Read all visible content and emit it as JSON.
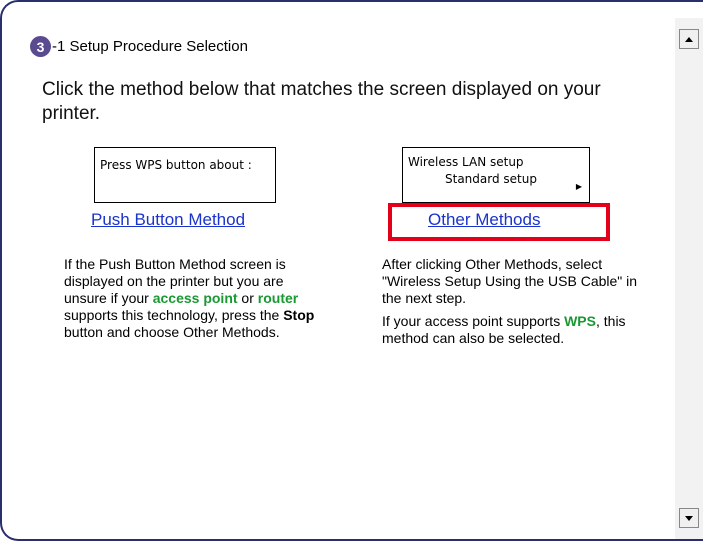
{
  "header": {
    "step_number": "3",
    "title": "-1 Setup Procedure Selection"
  },
  "instruction": "Click the method below that matches the screen displayed on your printer.",
  "left_option": {
    "screen_text": "Press WPS button about :",
    "link_label": "Push Button Method",
    "description": {
      "part1": "If the Push Button Method screen is displayed on the printer but you are unsure if your ",
      "access_point": "access point",
      "or": " or ",
      "router": "router",
      "part2": " supports this technology, press the ",
      "stop": "Stop",
      "part3": " button and choose Other Methods."
    }
  },
  "right_option": {
    "screen_line1": "Wireless LAN setup",
    "screen_line2": "Standard setup",
    "screen_arrow": "▶",
    "link_label": "Other Methods",
    "description1": "After clicking Other Methods, select \"Wireless Setup Using the USB Cable\" in the next step.",
    "description2": {
      "part1": "If your access point supports ",
      "wps": "WPS",
      "part2": ", this method can also be selected."
    }
  },
  "colors": {
    "link": "#1a33cc",
    "highlight": "#e3001b",
    "emphasis_green": "#1a9933",
    "step_badge": "#5a4a8f"
  }
}
